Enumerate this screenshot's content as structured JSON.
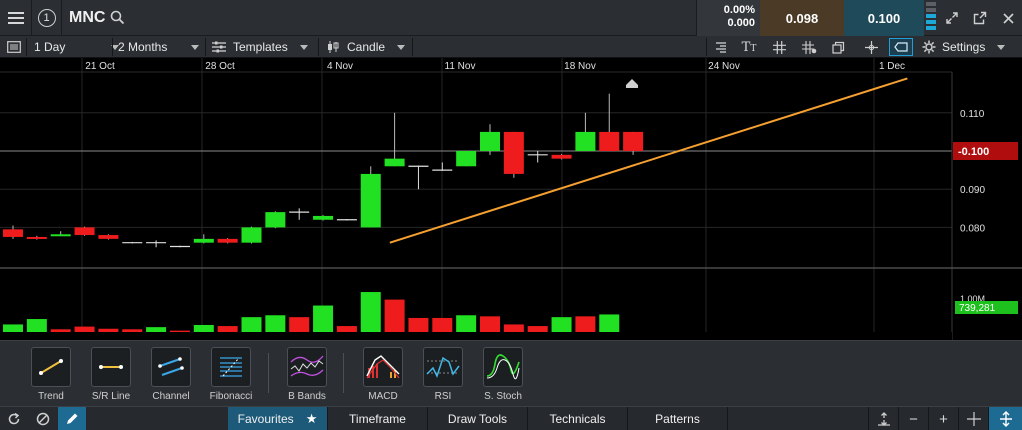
{
  "header": {
    "link_number": "1",
    "symbol": "MNC",
    "change_pct": "0.00%",
    "change_abs": "0.000",
    "bid": "0.098",
    "ask": "0.100"
  },
  "toolbar": {
    "interval": "1 Day",
    "range": "2 Months",
    "templates": "Templates",
    "chart_type": "Candle",
    "settings": "Settings"
  },
  "chart_data": {
    "type": "candlestick",
    "x_labels": [
      "21 Oct",
      "28 Oct",
      "4 Nov",
      "11 Nov",
      "18 Nov",
      "24 Nov",
      "1 Dec"
    ],
    "y_ticks": [
      "0.110",
      "0.100",
      "0.090",
      "0.080"
    ],
    "current_price_label": "0.100",
    "volume_label": "1.00M",
    "current_volume_label": "739,281",
    "candles": [
      {
        "o": 0.0795,
        "c": 0.0775,
        "h": 0.0805,
        "l": 0.077,
        "up": false
      },
      {
        "o": 0.0775,
        "c": 0.077,
        "h": 0.0778,
        "l": 0.0768,
        "up": false
      },
      {
        "o": 0.078,
        "c": 0.0782,
        "h": 0.079,
        "l": 0.0778,
        "up": true
      },
      {
        "o": 0.08,
        "c": 0.078,
        "h": 0.0802,
        "l": 0.0778,
        "up": false
      },
      {
        "o": 0.078,
        "c": 0.077,
        "h": 0.0782,
        "l": 0.0768,
        "up": false
      },
      {
        "o": 0.076,
        "c": 0.076,
        "h": 0.0762,
        "l": 0.0758,
        "up": false
      },
      {
        "o": 0.076,
        "c": 0.076,
        "h": 0.0766,
        "l": 0.0748,
        "up": false
      },
      {
        "o": 0.075,
        "c": 0.075,
        "h": 0.0752,
        "l": 0.0748,
        "up": false
      },
      {
        "o": 0.076,
        "c": 0.077,
        "h": 0.0782,
        "l": 0.0758,
        "up": true
      },
      {
        "o": 0.077,
        "c": 0.076,
        "h": 0.0772,
        "l": 0.0758,
        "up": false
      },
      {
        "o": 0.076,
        "c": 0.08,
        "h": 0.0802,
        "l": 0.0758,
        "up": true
      },
      {
        "o": 0.08,
        "c": 0.084,
        "h": 0.0842,
        "l": 0.0798,
        "up": true
      },
      {
        "o": 0.084,
        "c": 0.084,
        "h": 0.085,
        "l": 0.082,
        "up": false
      },
      {
        "o": 0.082,
        "c": 0.083,
        "h": 0.0832,
        "l": 0.0818,
        "up": true
      },
      {
        "o": 0.082,
        "c": 0.082,
        "h": 0.0822,
        "l": 0.0818,
        "up": false
      },
      {
        "o": 0.08,
        "c": 0.094,
        "h": 0.096,
        "l": 0.08,
        "up": true
      },
      {
        "o": 0.096,
        "c": 0.098,
        "h": 0.11,
        "l": 0.096,
        "up": true
      },
      {
        "o": 0.096,
        "c": 0.096,
        "h": 0.0962,
        "l": 0.09,
        "up": false
      },
      {
        "o": 0.095,
        "c": 0.095,
        "h": 0.097,
        "l": 0.0948,
        "up": false
      },
      {
        "o": 0.096,
        "c": 0.1,
        "h": 0.1,
        "l": 0.096,
        "up": true
      },
      {
        "o": 0.1,
        "c": 0.105,
        "h": 0.107,
        "l": 0.099,
        "up": true
      },
      {
        "o": 0.105,
        "c": 0.094,
        "h": 0.105,
        "l": 0.093,
        "up": false
      },
      {
        "o": 0.099,
        "c": 0.099,
        "h": 0.1,
        "l": 0.097,
        "up": false
      },
      {
        "o": 0.099,
        "c": 0.098,
        "h": 0.0992,
        "l": 0.0978,
        "up": false
      },
      {
        "o": 0.1,
        "c": 0.105,
        "h": 0.11,
        "l": 0.1,
        "up": true
      },
      {
        "o": 0.105,
        "c": 0.1,
        "h": 0.115,
        "l": 0.1,
        "up": false
      },
      {
        "o": 0.105,
        "c": 0.1,
        "h": 0.105,
        "l": 0.099,
        "up": false
      }
    ],
    "volumes": [
      0.28,
      0.48,
      0.1,
      0.2,
      0.12,
      0.1,
      0.18,
      0.05,
      0.26,
      0.22,
      0.55,
      0.62,
      0.55,
      0.98,
      0.22,
      1.48,
      1.2,
      0.52,
      0.52,
      0.62,
      0.58,
      0.28,
      0.22,
      0.55,
      0.58,
      0.65
    ],
    "volume_up": [
      true,
      true,
      false,
      false,
      false,
      false,
      true,
      false,
      true,
      false,
      true,
      true,
      false,
      true,
      false,
      true,
      false,
      false,
      false,
      true,
      false,
      false,
      false,
      true,
      false,
      true
    ],
    "trendline": {
      "from": [
        15.8,
        0.076
      ],
      "to": [
        37.5,
        0.119
      ]
    }
  },
  "indicators": [
    {
      "label": "Trend",
      "icon": "trend-icon"
    },
    {
      "label": "S/R Line",
      "icon": "sr-line-icon"
    },
    {
      "label": "Channel",
      "icon": "channel-icon"
    },
    {
      "label": "Fibonacci",
      "icon": "fibonacci-icon"
    },
    {
      "label": "B Bands",
      "icon": "bbands-icon"
    },
    {
      "label": "MACD",
      "icon": "macd-icon"
    },
    {
      "label": "RSI",
      "icon": "rsi-icon"
    },
    {
      "label": "S. Stoch",
      "icon": "stoch-icon"
    }
  ],
  "bottom_tabs": [
    {
      "label": "Favourites",
      "active": true
    },
    {
      "label": "Timeframe",
      "active": false
    },
    {
      "label": "Draw Tools",
      "active": false
    },
    {
      "label": "Technicals",
      "active": false
    },
    {
      "label": "Patterns",
      "active": false
    }
  ],
  "colors": {
    "up": "#22e022",
    "down": "#ee1c1c",
    "trend": "#f5a030",
    "price_tag": "#b00e0e",
    "volume_tag": "#1ec01e"
  }
}
